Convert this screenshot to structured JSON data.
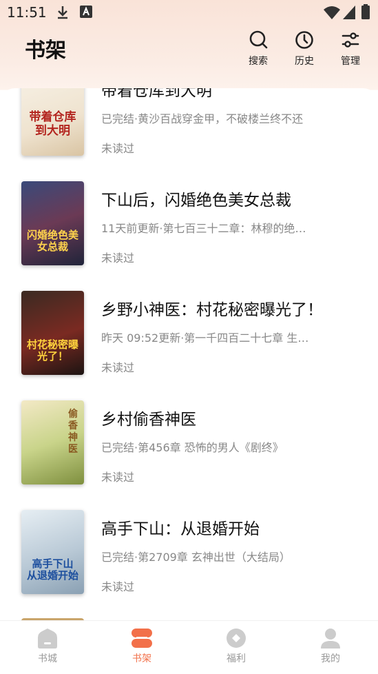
{
  "status_bar": {
    "time": "11:51"
  },
  "header": {
    "title": "书架",
    "actions": [
      {
        "label": "搜索",
        "icon": "search-icon"
      },
      {
        "label": "历史",
        "icon": "clock-icon"
      },
      {
        "label": "管理",
        "icon": "sliders-icon"
      }
    ]
  },
  "books": [
    {
      "title": "带着仓库到大明",
      "update": "已完结·黄沙百战穿金甲，不破楼兰终不还",
      "read_status": "未读过",
      "cover_text": "带着仓库到大明"
    },
    {
      "title": "下山后，闪婚绝色美女总裁",
      "update": "11天前更新·第七百三十二章：林穆的绝…",
      "read_status": "未读过",
      "cover_text": "闪婚绝色美女总裁"
    },
    {
      "title": "乡野小神医：村花秘密曝光了！",
      "update": "昨天 09:52更新·第一千四百二十七章 生…",
      "read_status": "未读过",
      "cover_text": "村花秘密曝光了！"
    },
    {
      "title": "乡村偷香神医",
      "update": "已完结·第456章 恐怖的男人《剧终》",
      "read_status": "未读过",
      "cover_text": "偷香神医"
    },
    {
      "title": "高手下山：从退婚开始",
      "update": "已完结·第2709章 玄神出世（大结局）",
      "read_status": "未读过",
      "cover_text": "高手下山 从退婚开始"
    }
  ],
  "bottom_nav": [
    {
      "label": "书城",
      "icon": "home-icon"
    },
    {
      "label": "书架",
      "icon": "bookshelf-icon",
      "active": true
    },
    {
      "label": "福利",
      "icon": "gift-icon"
    },
    {
      "label": "我的",
      "icon": "user-icon"
    }
  ],
  "colors": {
    "accent": "#f2704a",
    "inactive": "#cccccc"
  }
}
